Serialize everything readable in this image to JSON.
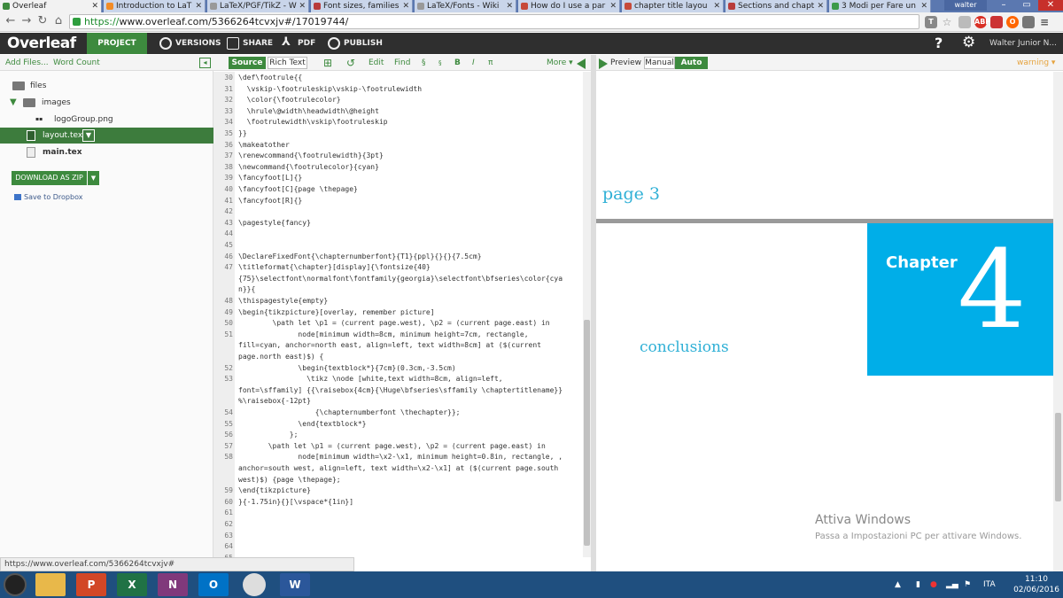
{
  "browser": {
    "tabs": [
      {
        "label": "Overleaf",
        "fav": "#3d8a3e",
        "active": true
      },
      {
        "label": "Introduction to LaT",
        "fav": "#f28c28"
      },
      {
        "label": "LaTeX/PGF/TikZ - W",
        "fav": "#999999"
      },
      {
        "label": "Font sizes, families",
        "fav": "#b83b3b"
      },
      {
        "label": "LaTeX/Fonts - Wiki",
        "fav": "#999999"
      },
      {
        "label": "How do I use a par",
        "fav": "#c74a3a"
      },
      {
        "label": "chapter title layou",
        "fav": "#c74a3a"
      },
      {
        "label": "Sections and chapt",
        "fav": "#b83b3b"
      },
      {
        "label": "3 Modi per Fare un",
        "fav": "#3d9a4a"
      }
    ],
    "window_user": "walter junior",
    "url_https": "https://",
    "url_rest": "www.overleaf.com/5366264tcvxjv#/17019744/"
  },
  "topbar": {
    "logo": "Overleaf",
    "project": "PROJECT",
    "versions": "VERSIONS",
    "share": "SHARE",
    "pdf": "PDF",
    "publish": "PUBLISH",
    "help": "?",
    "user": "Walter Junior N..."
  },
  "sidebar": {
    "add_files": "Add Files...",
    "word_count": "Word Count",
    "items": [
      {
        "label": "files",
        "type": "folder"
      },
      {
        "label": "images",
        "type": "folder-open"
      },
      {
        "label": "logoGroup.png",
        "type": "image"
      },
      {
        "label": "layout.tex",
        "type": "file",
        "selected": true
      },
      {
        "label": "main.tex",
        "type": "file"
      }
    ],
    "download": "DOWNLOAD AS ZIP",
    "dropbox": "Save to Dropbox"
  },
  "editor": {
    "source": "Source",
    "rich_text": "Rich Text",
    "edit": "Edit",
    "find": "Find",
    "section": "§",
    "subsection": "§",
    "bold": "B",
    "italic": "I",
    "math": "π",
    "more": "More",
    "lines": [
      {
        "n": "30",
        "t": "\\def\\footrule{{"
      },
      {
        "n": "31",
        "t": "  \\vskip-\\footruleskip\\vskip-\\footrulewidth"
      },
      {
        "n": "32",
        "t": "  \\color{\\footrulecolor}"
      },
      {
        "n": "33",
        "t": "  \\hrule\\@width\\headwidth\\@height"
      },
      {
        "n": "34",
        "t": "  \\footrulewidth\\vskip\\footruleskip"
      },
      {
        "n": "35",
        "t": "}}"
      },
      {
        "n": "36",
        "t": "\\makeatother"
      },
      {
        "n": "37",
        "t": "\\renewcommand{\\footrulewidth}{3pt}"
      },
      {
        "n": "38",
        "t": "\\newcommand{\\footrulecolor}{cyan}"
      },
      {
        "n": "39",
        "t": "\\fancyfoot[L]{}"
      },
      {
        "n": "40",
        "t": "\\fancyfoot[C]{page \\thepage}"
      },
      {
        "n": "41",
        "t": "\\fancyfoot[R]{}"
      },
      {
        "n": "42",
        "t": ""
      },
      {
        "n": "43",
        "t": "\\pagestyle{fancy}"
      },
      {
        "n": "44",
        "t": ""
      },
      {
        "n": "45",
        "t": ""
      },
      {
        "n": "46",
        "t": "\\DeclareFixedFont{\\chapternumberfont}{T1}{ppl}{}{}{7.5cm}"
      },
      {
        "n": "47",
        "t": "\\titleformat{\\chapter}[display]{\\fontsize{40}"
      },
      {
        "n": "",
        "t": "{75}\\selectfont\\normalfont\\fontfamily{georgia}\\selectfont\\bfseries\\color{cya"
      },
      {
        "n": "",
        "t": "n}}{"
      },
      {
        "n": "48",
        "t": "\\thispagestyle{empty}"
      },
      {
        "n": "49",
        "t": "\\begin{tikzpicture}[overlay, remember picture]"
      },
      {
        "n": "50",
        "t": "        \\path let \\p1 = (current page.west), \\p2 = (current page.east) in"
      },
      {
        "n": "51",
        "t": "              node[minimum width=8cm, minimum height=7cm, rectangle,"
      },
      {
        "n": "",
        "t": "fill=cyan, anchor=north east, align=left, text width=8cm] at ($(current"
      },
      {
        "n": "",
        "t": "page.north east)$) {"
      },
      {
        "n": "52",
        "t": "              \\begin{textblock*}{7cm}(0.3cm,-3.5cm)"
      },
      {
        "n": "53",
        "t": "                \\tikz \\node [white,text width=8cm, align=left,"
      },
      {
        "n": "",
        "t": "font=\\sffamily] {{\\raisebox{4cm}{\\Huge\\bfseries\\sffamily \\chaptertitlename}}"
      },
      {
        "n": "",
        "t": "%\\raisebox{-12pt}"
      },
      {
        "n": "54",
        "t": "                  {\\chapternumberfont \\thechapter}};"
      },
      {
        "n": "55",
        "t": "              \\end{textblock*}"
      },
      {
        "n": "56",
        "t": "            };"
      },
      {
        "n": "57",
        "t": "       \\path let \\p1 = (current page.west), \\p2 = (current page.east) in"
      },
      {
        "n": "58",
        "t": "              node[minimum width=\\x2-\\x1, minimum height=0.8in, rectangle, ,"
      },
      {
        "n": "",
        "t": "anchor=south west, align=left, text width=\\x2-\\x1] at ($(current page.south"
      },
      {
        "n": "",
        "t": "west)$) {page \\thepage};"
      },
      {
        "n": "59",
        "t": "\\end{tikzpicture}"
      },
      {
        "n": "60",
        "t": "}{-1.75in}{}[\\vspace*{1in}]"
      },
      {
        "n": "61",
        "t": ""
      },
      {
        "n": "62",
        "t": ""
      },
      {
        "n": "63",
        "t": ""
      },
      {
        "n": "64",
        "t": ""
      },
      {
        "n": "65",
        "t": ""
      }
    ]
  },
  "preview": {
    "label": "Preview",
    "manual": "Manual",
    "auto": "Auto",
    "warning": "warning",
    "page_footer": "page 3",
    "chapter_word": "Chapter",
    "chapter_number": "4",
    "chapter_title": "conclusions",
    "activate_title": "Attiva Windows",
    "activate_sub": "Passa a Impostazioni PC per attivare Windows."
  },
  "status_url": "https://www.overleaf.com/5366264tcvxjv#",
  "taskbar": {
    "apps": [
      {
        "name": "explorer",
        "glyph": "",
        "color": "#e8b84a"
      },
      {
        "name": "powerpoint",
        "glyph": "P",
        "color": "#d24726"
      },
      {
        "name": "excel",
        "glyph": "X",
        "color": "#207245"
      },
      {
        "name": "onenote",
        "glyph": "N",
        "color": "#80397b"
      },
      {
        "name": "outlook",
        "glyph": "O",
        "color": "#0072c6"
      },
      {
        "name": "chrome",
        "glyph": "",
        "color": "#dddddd"
      },
      {
        "name": "word",
        "glyph": "W",
        "color": "#2b579a"
      }
    ],
    "lang": "ITA",
    "time": "11:10",
    "date": "02/06/2016"
  },
  "colors": {
    "accent": "#3d8a3e",
    "chapter_box": "#00aee8"
  }
}
